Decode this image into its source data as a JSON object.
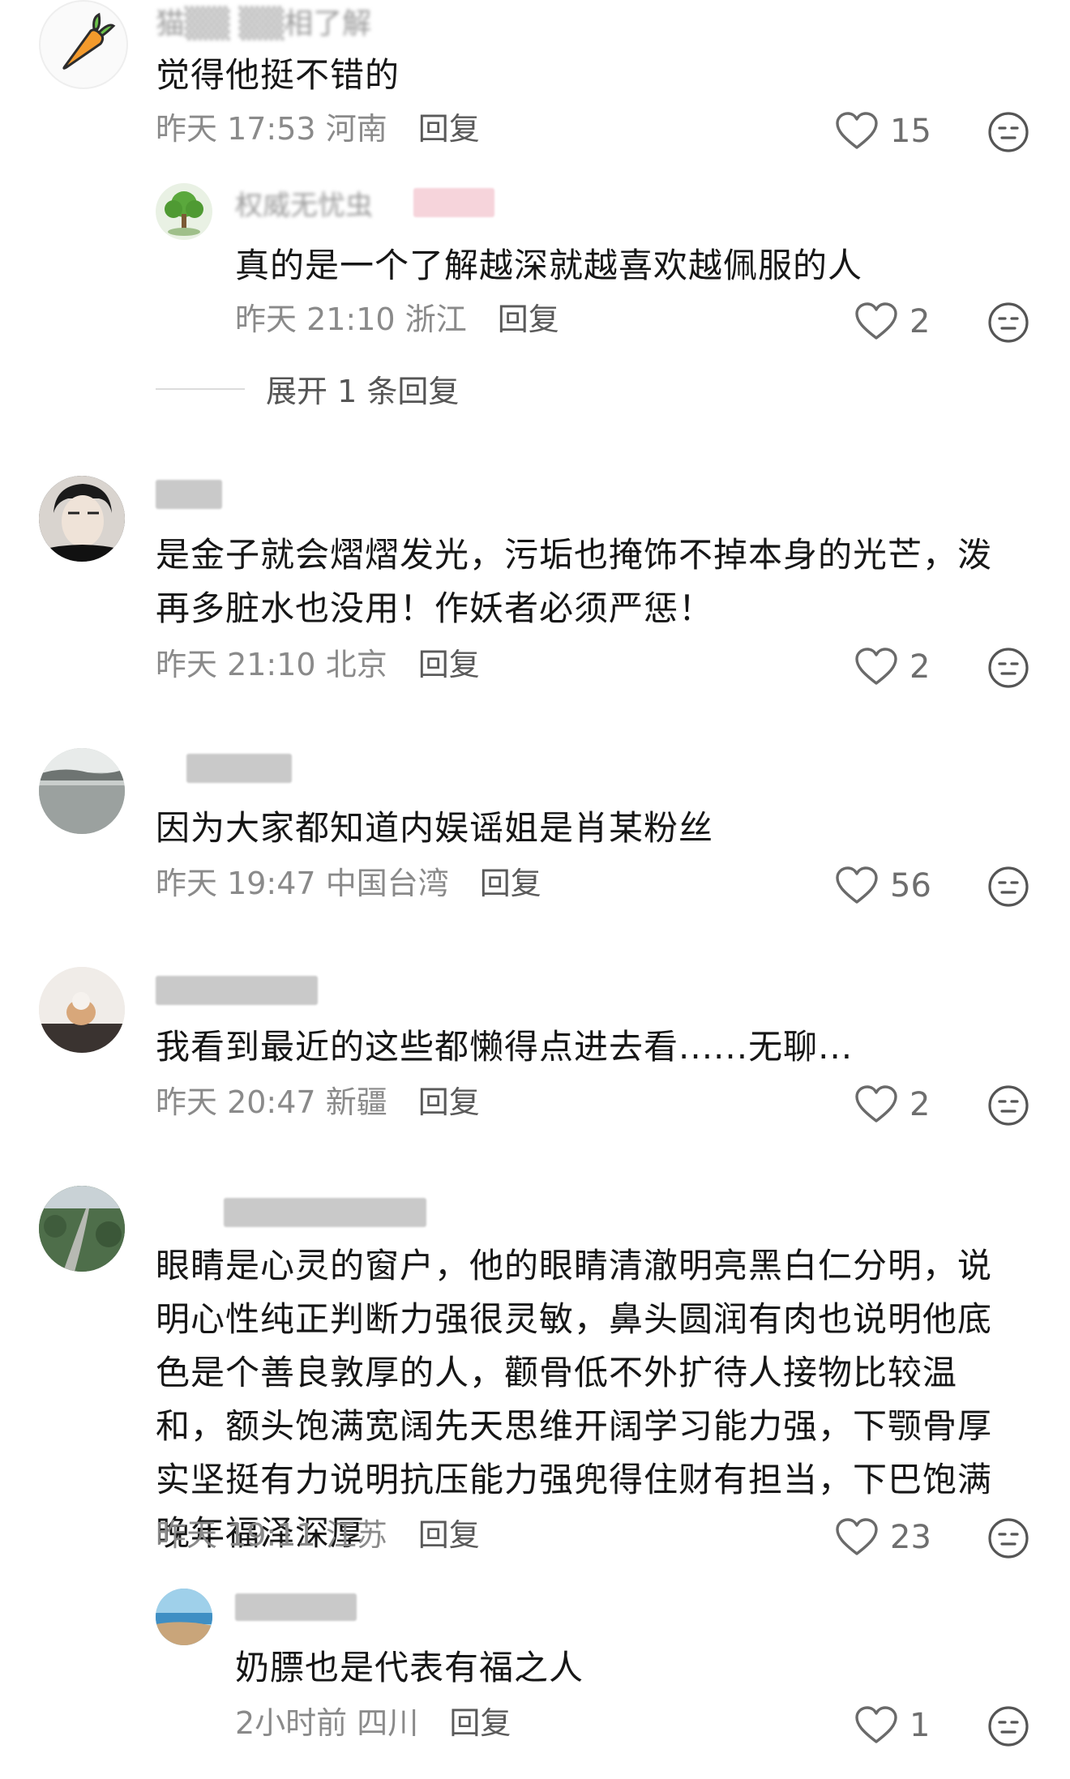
{
  "comments": [
    {
      "username": "猫▒▒ ▒▒相了解",
      "text": "觉得他挺不错的",
      "time": "昨天 17:53",
      "location": "河南",
      "reply": "回复",
      "likes": "15",
      "replies": [
        {
          "username": "权威无忧虫",
          "text": "真的是一个了解越深就越喜欢越佩服的人",
          "time": "昨天 21:10",
          "location": "浙江",
          "reply": "回复",
          "likes": "2"
        }
      ],
      "expand_label": "展开 1 条回复"
    },
    {
      "username": "若晴",
      "text": "是金子就会熠熠发光，污垢也掩饰不掉本身的光芒，泼再多脏水也没用！作妖者必须严惩！",
      "time": "昨天 21:10",
      "location": "北京",
      "reply": "回复",
      "likes": "2"
    },
    {
      "text": "因为大家都知道内娱谣姐是肖某粉丝",
      "time": "昨天 19:47",
      "location": "中国台湾",
      "reply": "回复",
      "likes": "56"
    },
    {
      "text": "我看到最近的这些都懒得点进去看......无聊...",
      "time": "昨天 20:47",
      "location": "新疆",
      "reply": "回复",
      "likes": "2"
    },
    {
      "text": "眼睛是心灵的窗户，他的眼睛清澈明亮黑白仁分明，说明心性纯正判断力强很灵敏，鼻头圆润有肉也说明他底色是个善良敦厚的人，颧骨低不外扩待人接物比较温和，额头饱满宽阔先天思维开阔学习能力强，下颚骨厚实坚挺有力说明抗压能力强兜得住财有担当，下巴饱满晚年福泽深厚",
      "time": "昨天 19:11",
      "location": "江苏",
      "reply": "回复",
      "likes": "23",
      "replies": [
        {
          "text": "奶膘也是代表有福之人",
          "time": "2小时前",
          "location": "四川",
          "reply": "回复",
          "likes": "1"
        }
      ]
    }
  ],
  "icons": {
    "like": "heart-outline-icon",
    "emoji": "neutral-face-icon"
  },
  "colors": {
    "meta": "#8a8a8a",
    "text": "#161616"
  }
}
